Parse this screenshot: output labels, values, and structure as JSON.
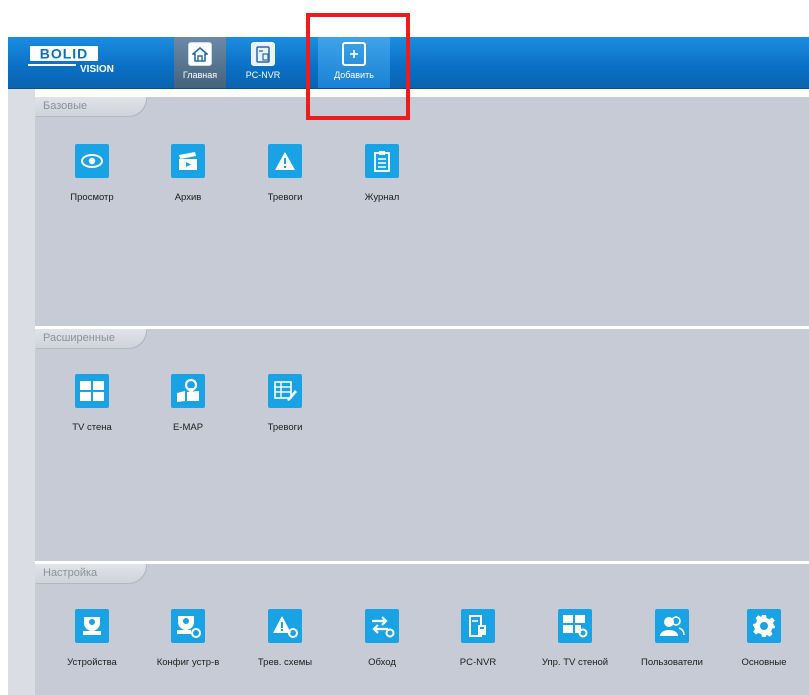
{
  "logo": {
    "text": "BOLID",
    "subtext": "VISION"
  },
  "nav": {
    "tabs": [
      {
        "label": "Главная",
        "icon": "home-icon"
      },
      {
        "label": "PC-NVR",
        "icon": "server-icon"
      },
      {
        "label": "Добавить",
        "icon": "plus-icon"
      }
    ]
  },
  "sections": [
    {
      "title": "Базовые",
      "items": [
        {
          "label": "Просмотр",
          "icon": "eye-icon"
        },
        {
          "label": "Архив",
          "icon": "clapperboard-icon"
        },
        {
          "label": "Тревоги",
          "icon": "warning-icon"
        },
        {
          "label": "Журнал",
          "icon": "clipboard-icon"
        }
      ]
    },
    {
      "title": "Расширенные",
      "items": [
        {
          "label": "TV стена",
          "icon": "grid-icon"
        },
        {
          "label": "E-MAP",
          "icon": "map-pin-icon"
        },
        {
          "label": "Тревоги",
          "icon": "table-edit-icon"
        }
      ]
    },
    {
      "title": "Настройка",
      "items": [
        {
          "label": "Устройства",
          "icon": "camera-icon"
        },
        {
          "label": "Конфиг устр-в",
          "icon": "camera-gear-icon"
        },
        {
          "label": "Трев. схемы",
          "icon": "warning-gear-icon"
        },
        {
          "label": "Обход",
          "icon": "arrows-gear-icon"
        },
        {
          "label": "PC-NVR",
          "icon": "server-icon"
        },
        {
          "label": "Упр. TV стеной",
          "icon": "grid-gear-icon"
        },
        {
          "label": "Пользователи",
          "icon": "users-icon"
        },
        {
          "label": "Основные",
          "icon": "gear-icon"
        }
      ]
    }
  ],
  "colors": {
    "header": "#0a6fc4",
    "tile_icon": "#1aa3e4",
    "panel": "#c6cbd5",
    "highlight": "#ee1c1c"
  }
}
